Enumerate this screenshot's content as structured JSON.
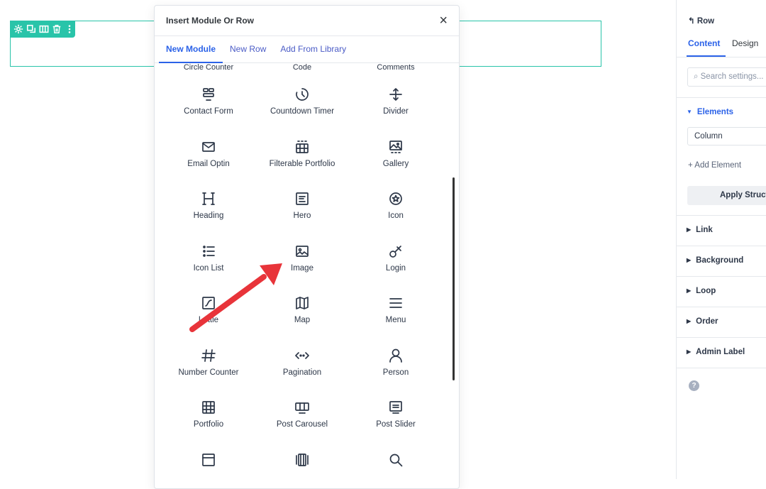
{
  "row_toolbar": {
    "icons": [
      "gear-icon",
      "duplicate-icon",
      "columns-icon",
      "trash-icon",
      "more-icon"
    ],
    "color": "#29c4a9"
  },
  "modal": {
    "title": "Insert Module Or Row",
    "close_label": "×",
    "tabs": [
      {
        "label": "New Module",
        "active": true
      },
      {
        "label": "New Row",
        "active": false
      },
      {
        "label": "Add From Library",
        "active": false
      }
    ],
    "partial_row": [
      "Circle Counter",
      "Code",
      "Comments"
    ],
    "modules": [
      [
        {
          "label": "Contact Form",
          "icon": "contact-form-icon"
        },
        {
          "label": "Countdown Timer",
          "icon": "countdown-timer-icon"
        },
        {
          "label": "Divider",
          "icon": "divider-icon"
        }
      ],
      [
        {
          "label": "Email Optin",
          "icon": "email-icon"
        },
        {
          "label": "Filterable Portfolio",
          "icon": "filterable-portfolio-icon"
        },
        {
          "label": "Gallery",
          "icon": "gallery-icon"
        }
      ],
      [
        {
          "label": "Heading",
          "icon": "heading-icon"
        },
        {
          "label": "Hero",
          "icon": "hero-icon"
        },
        {
          "label": "Icon",
          "icon": "star-icon"
        }
      ],
      [
        {
          "label": "Icon List",
          "icon": "icon-list-icon"
        },
        {
          "label": "Image",
          "icon": "image-icon"
        },
        {
          "label": "Login",
          "icon": "key-icon"
        }
      ],
      [
        {
          "label": "Lottie",
          "icon": "lottie-icon"
        },
        {
          "label": "Map",
          "icon": "map-icon"
        },
        {
          "label": "Menu",
          "icon": "menu-icon"
        }
      ],
      [
        {
          "label": "Number Counter",
          "icon": "hash-icon"
        },
        {
          "label": "Pagination",
          "icon": "pagination-icon"
        },
        {
          "label": "Person",
          "icon": "person-icon"
        }
      ],
      [
        {
          "label": "Portfolio",
          "icon": "portfolio-icon"
        },
        {
          "label": "Post Carousel",
          "icon": "post-carousel-icon"
        },
        {
          "label": "Post Slider",
          "icon": "post-slider-icon"
        }
      ],
      [
        {
          "label": "",
          "icon": "post-title-icon"
        },
        {
          "label": "",
          "icon": "pricing-icon"
        },
        {
          "label": "",
          "icon": "search-icon"
        }
      ]
    ]
  },
  "annotation_arrow_color": "#e8343a",
  "panel": {
    "breadcrumb": "↰ Row",
    "tabs": [
      {
        "label": "Content",
        "active": true
      },
      {
        "label": "Design",
        "active": false
      }
    ],
    "search_placeholder": "⌕ Search settings...",
    "elements_label": "Elements",
    "select_value": "Column",
    "add_element_label": "+  Add Element",
    "apply_button_label": "Apply Structure",
    "sections": [
      "Link",
      "Background",
      "Loop",
      "Order",
      "Admin Label"
    ],
    "help_label": "?"
  }
}
